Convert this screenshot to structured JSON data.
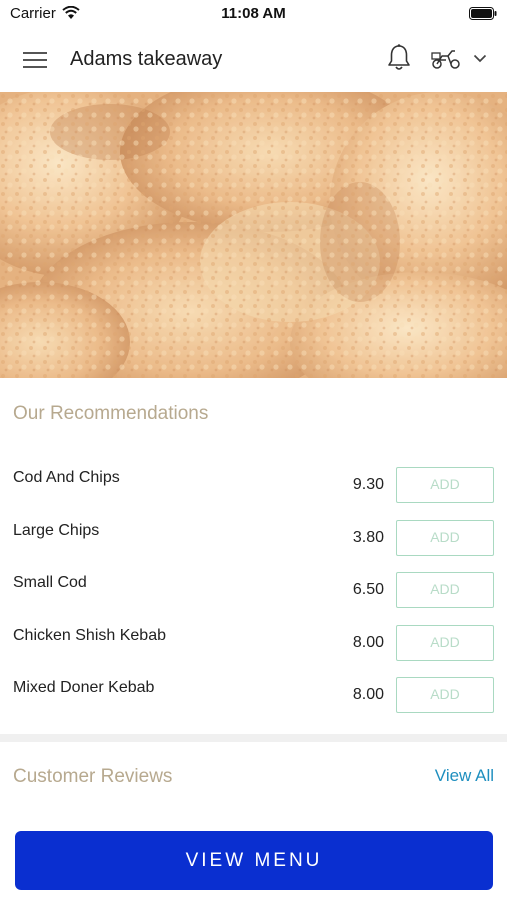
{
  "status_bar": {
    "carrier": "Carrier",
    "time": "11:08 AM"
  },
  "header": {
    "title": "Adams takeaway"
  },
  "recommendations": {
    "title": "Our Recommendations",
    "items": [
      {
        "name": "Cod And Chips",
        "price": "9.30",
        "add_label": "ADD"
      },
      {
        "name": "Large Chips",
        "price": "3.80",
        "add_label": "ADD"
      },
      {
        "name": "Small Cod",
        "price": "6.50",
        "add_label": "ADD"
      },
      {
        "name": "Chicken Shish Kebab",
        "price": "8.00",
        "add_label": "ADD"
      },
      {
        "name": "Mixed Doner Kebab",
        "price": "8.00",
        "add_label": "ADD"
      }
    ]
  },
  "reviews": {
    "title": "Customer Reviews",
    "view_all_label": "View All"
  },
  "footer": {
    "view_menu_label": "VIEW MENU"
  },
  "icons": [
    "wifi-icon",
    "battery-icon",
    "menu-icon",
    "bell-icon",
    "scooter-icon",
    "chevron-down-icon"
  ],
  "colors": {
    "accent_blue": "#0a2fd0",
    "add_border": "#a9d9c1",
    "section_title": "#b7a98f",
    "link": "#1f8fbf"
  }
}
